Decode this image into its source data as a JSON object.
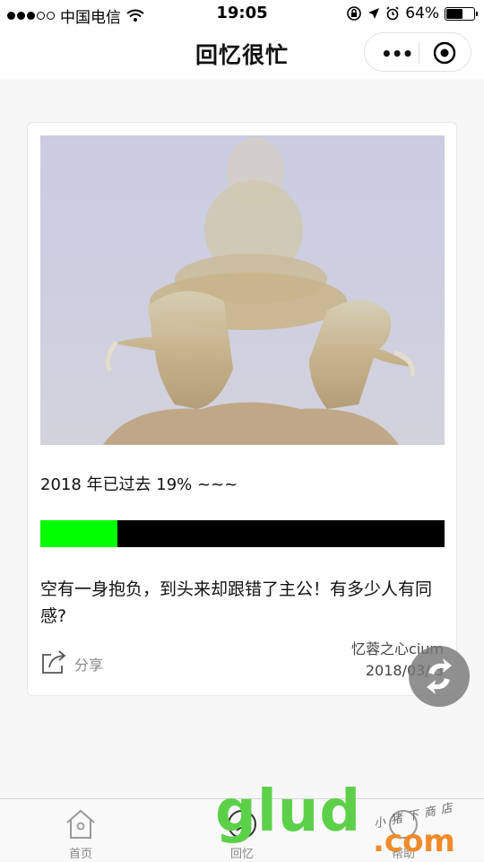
{
  "status_bar": {
    "carrier": "中国电信",
    "time": "19:05",
    "battery": "64%",
    "battery_level": 0.64,
    "signal_bars_filled": 3,
    "signal_bars_total": 5
  },
  "nav": {
    "title": "回忆很忙"
  },
  "card": {
    "image_icon": "photo",
    "title": "2018 年已过去 19% ~~~",
    "progress": 0.19,
    "text": "空有一身抱负，到头来却跟错了主公！有多少人有同感?",
    "share_label": "分享",
    "author": "忆蓉之心cium",
    "date": "2018/03/ 3"
  },
  "tabs": [
    {
      "label": "首页",
      "icon": "home-icon"
    },
    {
      "label": "回忆",
      "icon": "compass-icon"
    },
    {
      "label": "帮助",
      "icon": "help-icon"
    }
  ],
  "watermark": {
    "main": "glud",
    "com": ".com",
    "shop": "小猪下商店"
  },
  "colors": {
    "progress_fill": "#00ff00",
    "progress_track": "#000000",
    "watermark_green": "#5dd04a",
    "watermark_orange": "#f08a2a"
  }
}
